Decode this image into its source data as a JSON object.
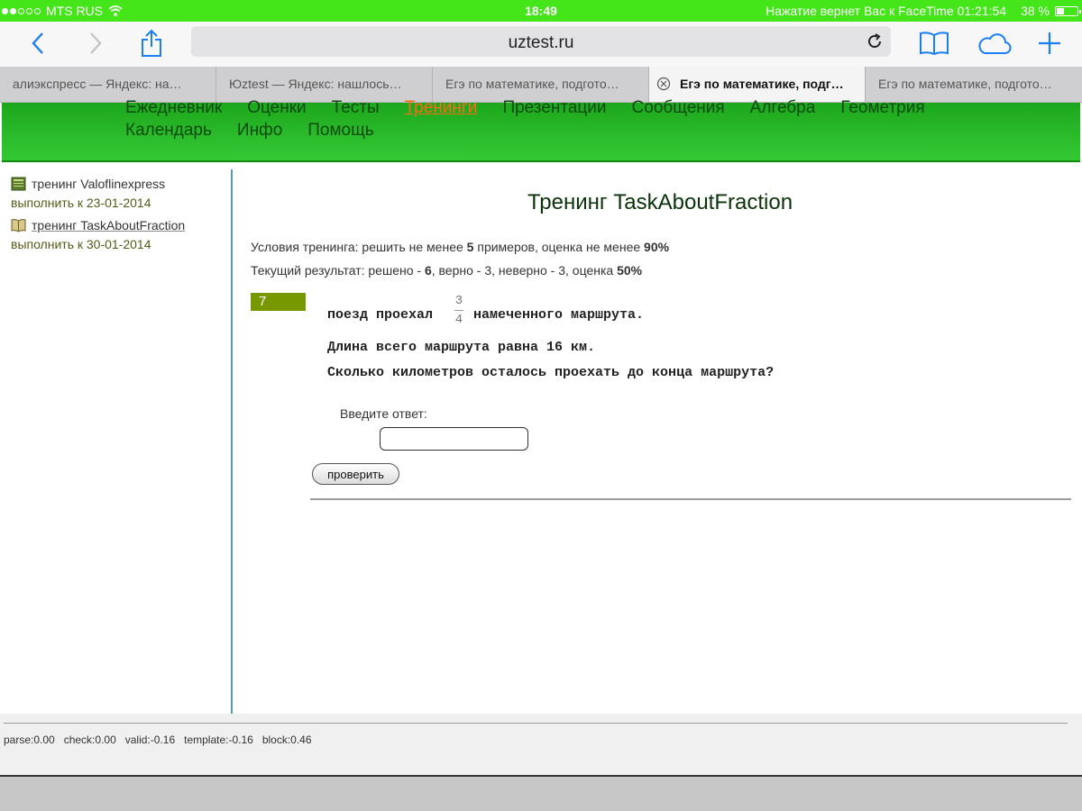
{
  "status_bar": {
    "carrier": "MTS RUS",
    "time": "18:49",
    "facetime_text": "Нажатие вернет Вас к FaceTime 01:21:54",
    "battery": "38 %",
    "battery_level": 0.38
  },
  "browser": {
    "url": "uztest.ru",
    "icons": {
      "back": "chevron-left-icon",
      "forward": "chevron-right-icon",
      "share": "share-icon",
      "reload": "reload-icon",
      "bookmarks": "book-icon",
      "cloud": "cloud-icon",
      "new_tab": "plus-icon"
    },
    "tabs": [
      {
        "label": "алиэкспресс — Яндекс: на…",
        "active": false
      },
      {
        "label": "Юztest — Яндекс: нашлось…",
        "active": false
      },
      {
        "label": "Егэ по математике, подгото…",
        "active": false
      },
      {
        "label": "Егэ по математике, подг…",
        "active": true
      },
      {
        "label": "Егэ по математике, подгото…",
        "active": false
      }
    ]
  },
  "nav": {
    "row1": [
      "Ежедневник",
      "Оценки",
      "Тесты",
      "Тренинги",
      "Презентации",
      "Сообщения",
      "Алгебра",
      "Геометрия"
    ],
    "row2": [
      "Календарь",
      "Инфо",
      "Помощь"
    ],
    "active": "Тренинги"
  },
  "sidebar": {
    "items": [
      {
        "title": "тренинг Valoflinexpress",
        "due": "выполнить к 23-01-2014"
      },
      {
        "title": "тренинг TaskAboutFraction",
        "due": "выполнить к 30-01-2014"
      }
    ]
  },
  "main": {
    "title": "Тренинг TaskAboutFraction",
    "conditions": {
      "prefix": "Условия тренинга: решить не менее ",
      "min_examples": "5",
      "middle": " примеров, оценка не менее ",
      "min_grade": "90%"
    },
    "result": {
      "prefix": "Текущий результат: решено - ",
      "solved": "6",
      "middle": ", верно - 3, неверно - 3, оценка ",
      "grade": "50%"
    },
    "problem_number": "7",
    "problem": {
      "line1_before": "поезд проехал",
      "fraction_num": "3",
      "fraction_den": "4",
      "line1_after": "намеченного маршрута.",
      "line2": "Длина всего маршрута равна 16 км.",
      "line3": "Сколько километров осталось проехать до конца маршрута?"
    },
    "answer_label": "Введите ответ:",
    "answer_value": "",
    "check_button": "проверить"
  },
  "footer": {
    "stats": "parse:0.00   check:0.00   valid:-0.16   template:-0.16   block:0.46"
  },
  "colors": {
    "status_bar": "#44e619",
    "header_green": "#1ca71c",
    "active_nav": "#ff6a13",
    "badge": "#779800",
    "ios_blue": "#1a7ef5"
  }
}
